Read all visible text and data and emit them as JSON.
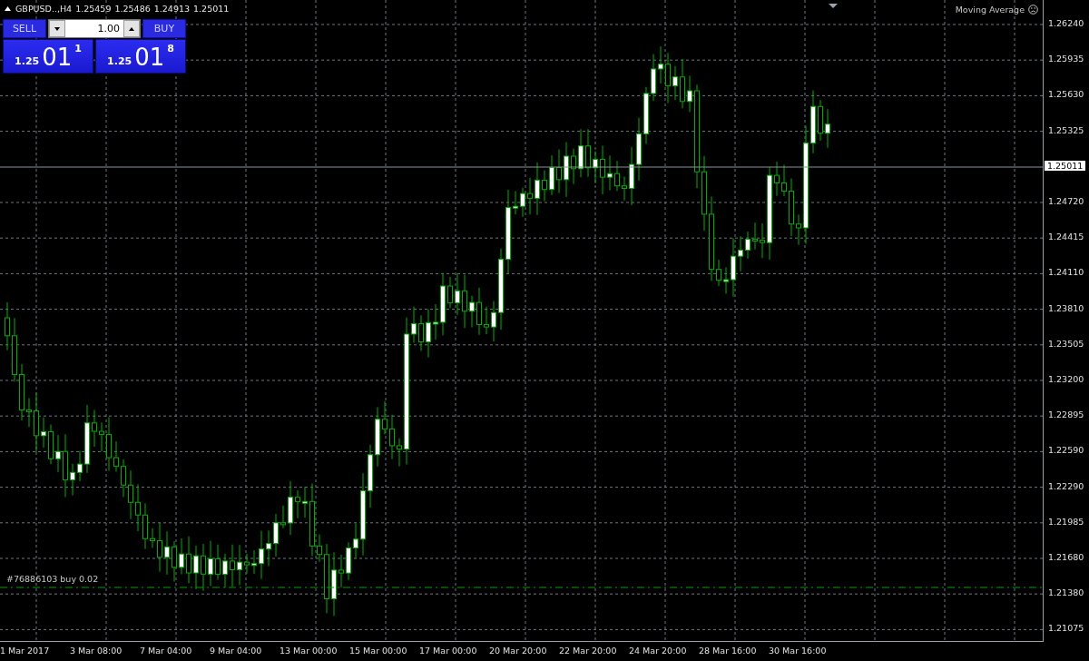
{
  "header": {
    "symbol": "GBPUSD..,H4",
    "ohlc": [
      "1.25459",
      "1.25486",
      "1.24913",
      "1.25011"
    ]
  },
  "trade_panel": {
    "volume": "1.00",
    "sell": {
      "label": "SELL",
      "price_prefix": "1.25",
      "price_big": "01",
      "price_point": "1"
    },
    "buy": {
      "label": "BUY",
      "price_prefix": "1.25",
      "price_big": "01",
      "price_point": "8"
    }
  },
  "indicator": "Moving Average",
  "price_axis": [
    "1.26240",
    "1.25935",
    "1.25630",
    "1.25325",
    "1.24720",
    "1.24415",
    "1.24110",
    "1.23810",
    "1.23505",
    "1.23200",
    "1.22895",
    "1.22590",
    "1.22290",
    "1.21985",
    "1.21680",
    "1.21380",
    "1.21075"
  ],
  "current_price": "1.25011",
  "order_label": "#76886103 buy 0.02",
  "time_axis": [
    "1 Mar 2017",
    "3 Mar 08:00",
    "7 Mar 04:00",
    "9 Mar 04:00",
    "13 Mar 00:00",
    "15 Mar 00:00",
    "17 Mar 00:00",
    "20 Mar 20:00",
    "22 Mar 20:00",
    "24 Mar 20:00",
    "28 Mar 16:00",
    "30 Mar 16:00"
  ]
}
